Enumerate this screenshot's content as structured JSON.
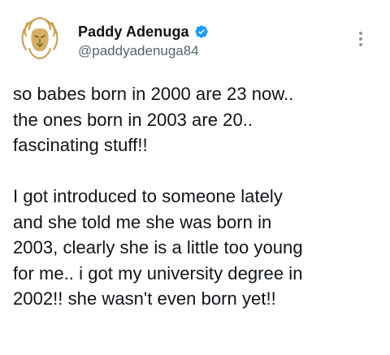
{
  "author": {
    "display_name": "Paddy Adenuga",
    "handle": "@paddyadenuga84",
    "verified_icon": "verified-badge-icon",
    "avatar_icon": "lion-logo-icon",
    "brand_color": "#c8a25a",
    "verified_color": "#1d9bf0"
  },
  "menu": {
    "more_icon": "more-vertical-icon"
  },
  "tweet": {
    "paragraph1": [
      "so babes born in 2000 are 23 now..",
      "the ones born in 2003 are 20..",
      "fascinating stuff!!"
    ],
    "paragraph2": [
      "I got introduced to someone lately",
      "and she told me she was born in",
      "2003, clearly she is a little too young",
      "for me.. i got my university degree in",
      "2002!! she wasn't even born yet!!"
    ]
  }
}
